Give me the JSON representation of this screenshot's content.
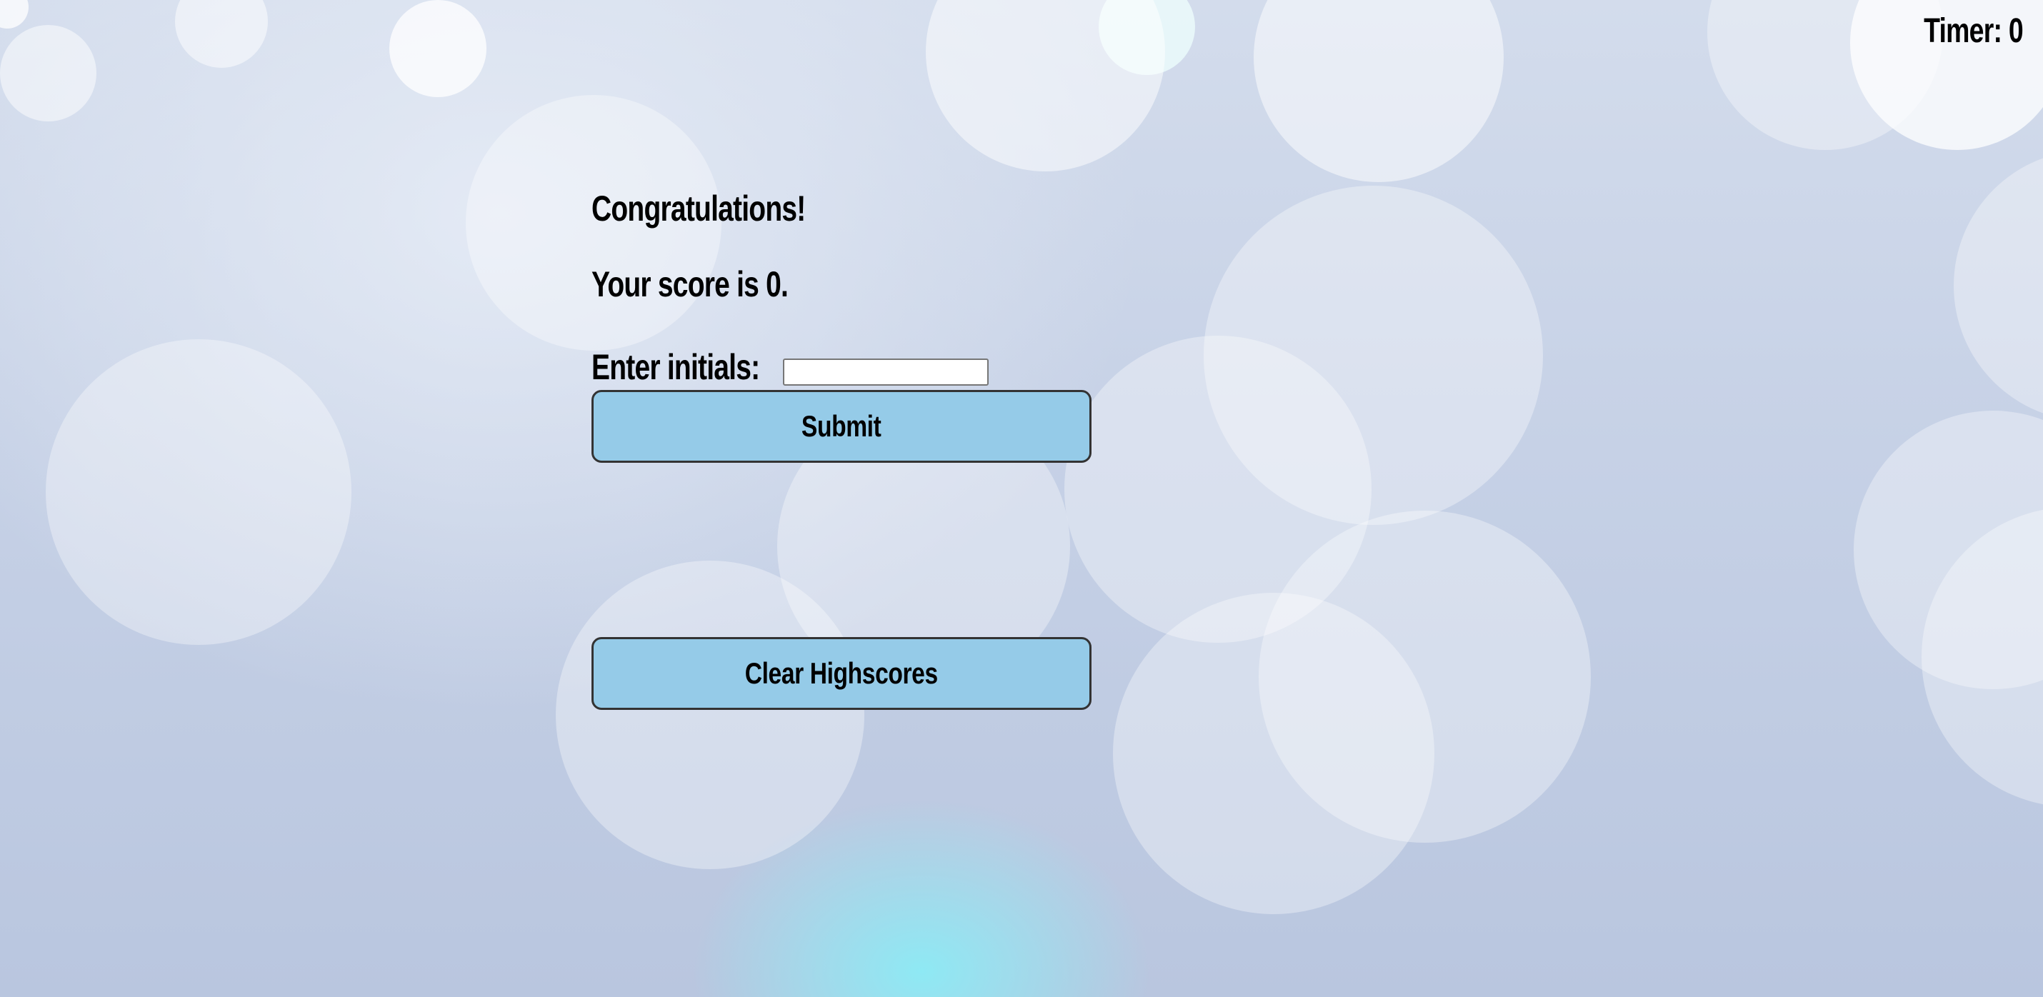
{
  "header": {
    "timer_text": "Timer: 0"
  },
  "results": {
    "title": "Congratulations!",
    "score_text": "Your score is 0.",
    "initials_label": "Enter initials:",
    "initials_value": "",
    "submit_label": "Submit"
  },
  "highscores": {
    "clear_label": "Clear Highscores"
  },
  "colors": {
    "button_bg": "#95cbe8",
    "button_border": "#333333",
    "text": "#000000"
  }
}
